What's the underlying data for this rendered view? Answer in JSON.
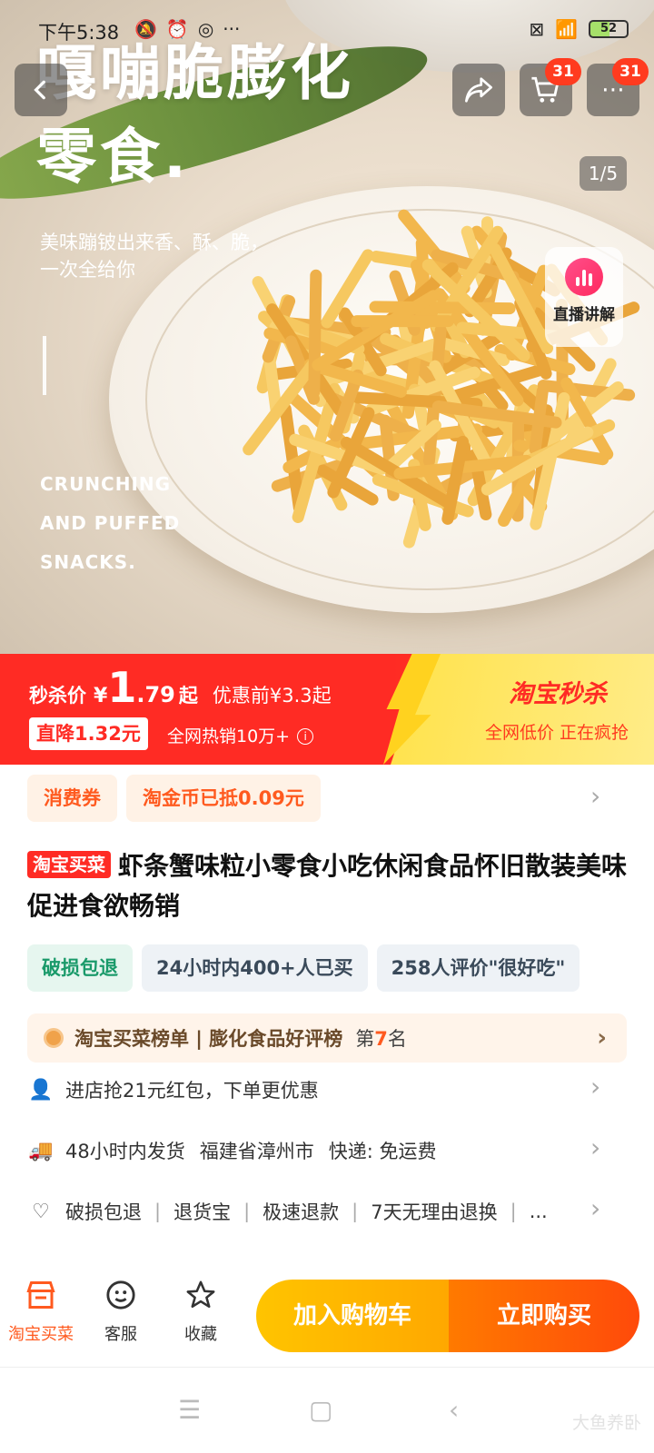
{
  "status_bar": {
    "time": "下午5:38",
    "battery": "52",
    "overflow": "···"
  },
  "hero": {
    "headline1": "嘎嘣脆膨化",
    "headline2": "零食.",
    "subtitle": "美味蹦铍出来香、酥、脆，一次全给你",
    "english_lines": [
      "CRUNCHING",
      "AND PUFFED",
      "SNACKS."
    ],
    "page_indicator": "1/5",
    "live_label": "直播讲解",
    "cart_badge": "31",
    "more_badge": "31"
  },
  "price_banner": {
    "seckill_label": "秒杀价",
    "currency": "¥",
    "price_int": "1",
    "price_dec": ".79",
    "price_suffix": "起",
    "before_price": "优惠前¥3.3起",
    "discount": "直降1.32元",
    "hot_sales": "全网热销10万+",
    "brand": "淘宝秒杀",
    "slogan": "全网低价 正在疯抢"
  },
  "coupons": [
    "消费券",
    "淘金币已抵0.09元"
  ],
  "product": {
    "tag": "淘宝买菜",
    "title": "虾条蟹味粒小零食小吃休闲食品怀旧散装美味促进食欲畅销"
  },
  "features": [
    "破损包退",
    "24小时内400+人已买",
    "258人评价\"很好吃\""
  ],
  "ranking": {
    "text": "淘宝买菜榜单 | 膨化食品好评榜",
    "prefix": "第",
    "number": "7",
    "suffix": "名"
  },
  "store_promo": "进店抢21元红包，下单更优惠",
  "shipping": {
    "time": "48小时内发货",
    "origin": "福建省漳州市",
    "express": "快递: 免运费"
  },
  "services": [
    "破损包退",
    "退货宝",
    "极速退款",
    "7天无理由退换",
    "..."
  ],
  "bottom_bar": {
    "items": [
      {
        "label": "淘宝买菜",
        "icon": "store-icon"
      },
      {
        "label": "客服",
        "icon": "service-icon"
      },
      {
        "label": "收藏",
        "icon": "star-icon"
      }
    ],
    "add_to_cart": "加入购物车",
    "buy_now": "立即购买"
  },
  "watermark": "大鱼养卧",
  "colors": {
    "seckill_red": "#ff2b24",
    "accent_orange": "#ff5a1f",
    "cart_yellow": "#ffb800"
  }
}
